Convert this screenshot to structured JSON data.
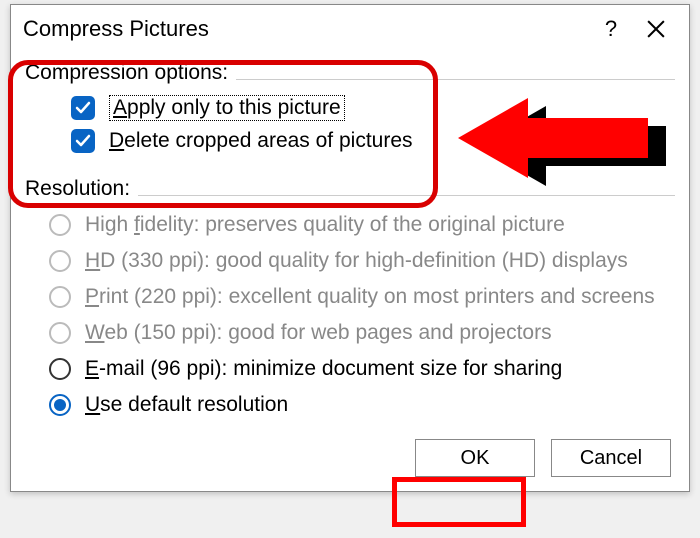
{
  "dialog": {
    "title": "Compress Pictures",
    "compression_section": {
      "label": "Compression options:",
      "apply_only": "pply only to this picture",
      "apply_only_prefix": "A",
      "delete_cropped": "elete cropped areas of pictures",
      "delete_cropped_prefix": "D"
    },
    "resolution_section": {
      "label": "Resolution:",
      "options": [
        {
          "prefix": "f",
          "before": "High ",
          "after": "idelity: preserves quality of the original picture",
          "state": "disabled"
        },
        {
          "prefix": "H",
          "before": "",
          "after": "D (330 ppi): good quality for high-definition (HD) displays",
          "state": "disabled"
        },
        {
          "prefix": "P",
          "before": "",
          "after": "rint (220 ppi): excellent quality on most printers and screens",
          "state": "disabled"
        },
        {
          "prefix": "W",
          "before": "",
          "after": "eb (150 ppi): good for web pages and projectors",
          "state": "disabled"
        },
        {
          "prefix": "E",
          "before": "",
          "after": "-mail (96 ppi): minimize document size for sharing",
          "state": "enabled"
        },
        {
          "prefix": "U",
          "before": "",
          "after": "se default resolution",
          "state": "selected"
        }
      ]
    },
    "buttons": {
      "ok": "OK",
      "cancel": "Cancel"
    }
  }
}
